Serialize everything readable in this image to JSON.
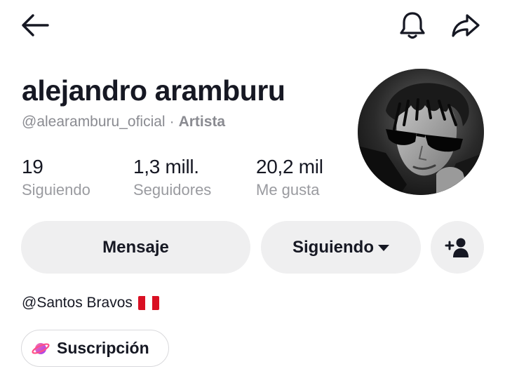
{
  "header": {
    "back_icon": "arrow-left-icon",
    "bell_icon": "bell-icon",
    "share_icon": "share-arrow-icon"
  },
  "profile": {
    "name": "alejandro aramburu",
    "handle": "@alearamburu_oficial",
    "separator": "·",
    "role": "Artista",
    "avatar": "profile-photo-black-and-white-sunglasses"
  },
  "stats": [
    {
      "value": "19",
      "label": "Siguiendo"
    },
    {
      "value": "1,3 mill.",
      "label": "Seguidores"
    },
    {
      "value": "20,2 mil",
      "label": "Me gusta"
    }
  ],
  "actions": {
    "message_label": "Mensaje",
    "following_label": "Siguiendo",
    "add_friend_icon": "add-user-icon"
  },
  "bio": {
    "text": "@Santos Bravos",
    "flag": "peru-flag"
  },
  "subscription": {
    "label": "Suscripción",
    "icon": "planet-icon"
  },
  "colors": {
    "text": "#161823",
    "secondary": "#8a8b91",
    "button_bg": "#efeff0",
    "peru_red": "#d91023",
    "planet_pink": "#fe2c55"
  }
}
